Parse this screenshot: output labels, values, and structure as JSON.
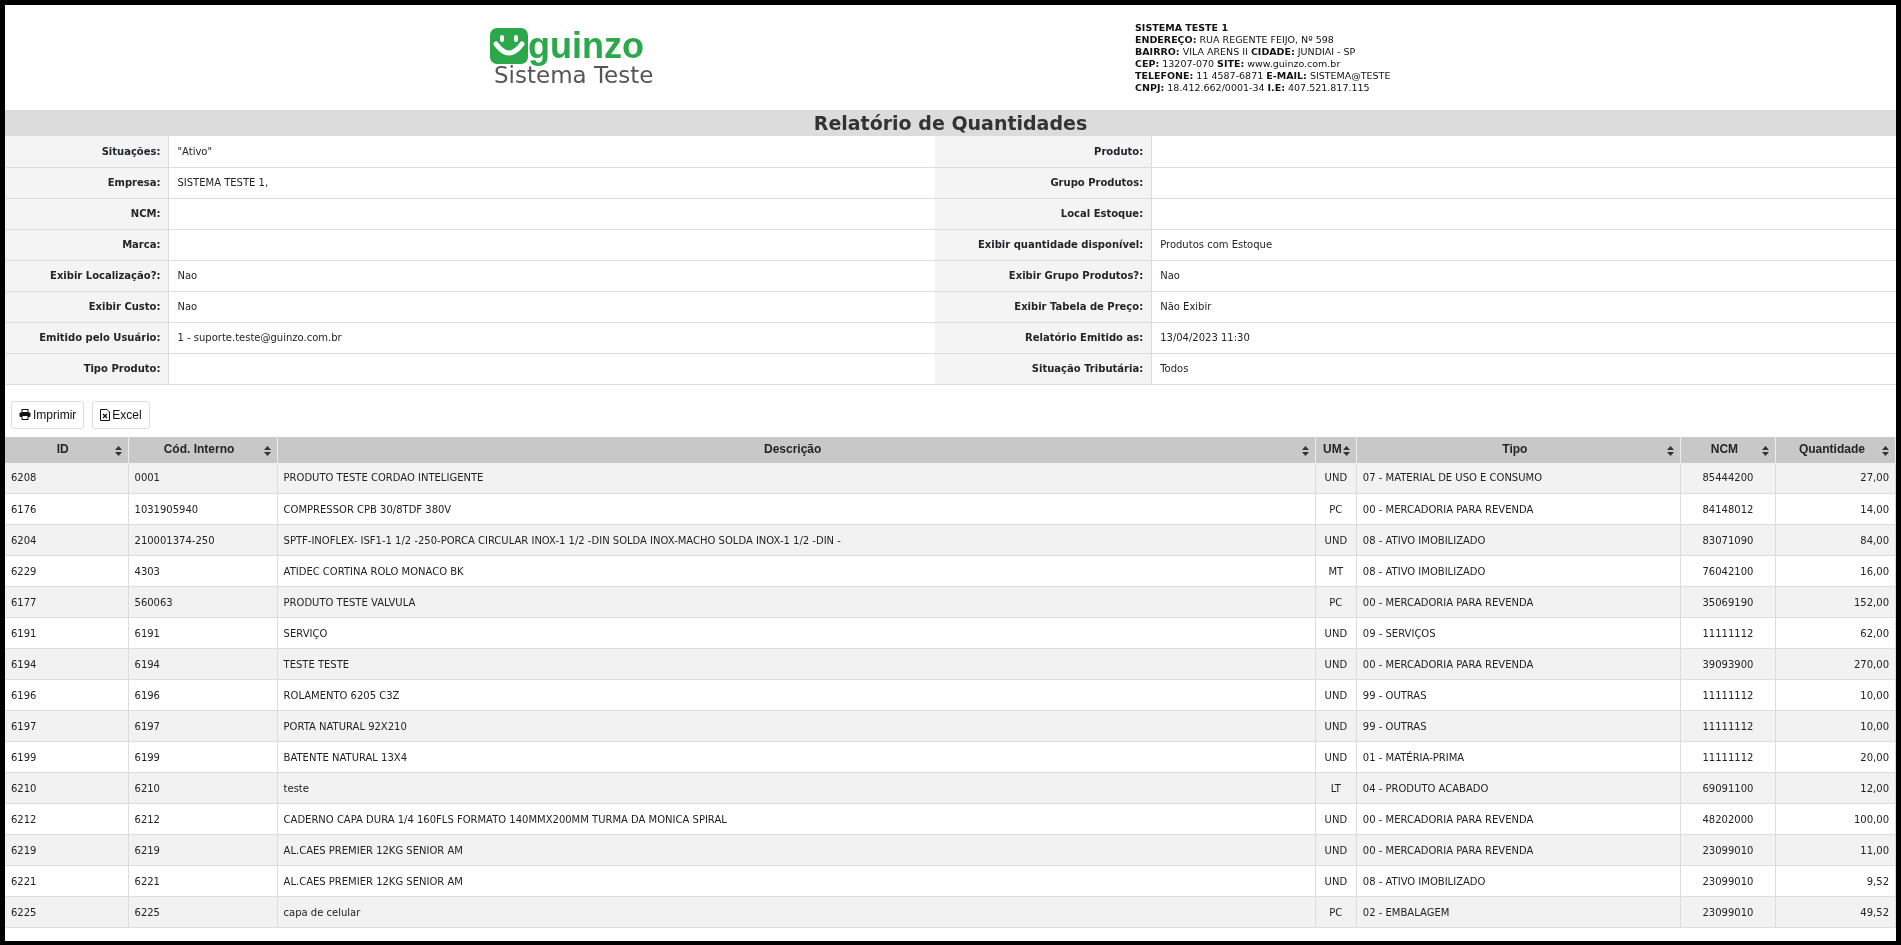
{
  "header": {
    "logo": {
      "brand": "guinzo",
      "subtitle": "Sistema Teste"
    },
    "company_lines": [
      "SISTEMA TESTE 1",
      "**ENDEREÇO:** RUA REGENTE FEIJO, Nº 598",
      "**BAIRRO:** VILA ARENS II **CIDADE:** JUNDIAI - SP",
      "**CEP:** 13207-070 **SITE:** www.guinzo.com.br",
      "**TELEFONE:** 11 4587-6871 **E-MAIL:** SISTEMA@TESTE",
      "**CNPJ:** 18.412.662/0001-34 **I.E:** 407.521.817.115"
    ]
  },
  "report_title": "Relatório de Quantidades",
  "filters": [
    {
      "left": {
        "label": "Situações:",
        "value": "\"Ativo\""
      },
      "right": {
        "label": "Produto:"
      }
    },
    {
      "left": {
        "label": "Empresa:",
        "value": "SISTEMA TESTE 1,"
      },
      "right": {
        "label": "Grupo Produtos:"
      }
    },
    {
      "left": {
        "label": "NCM:"
      },
      "right": {
        "label": "Local Estoque:"
      }
    },
    {
      "left": {
        "label": "Marca:"
      },
      "right": {
        "label": "Exibir quantidade disponível:",
        "value": "Produtos com Estoque"
      }
    },
    {
      "left": {
        "label": "Exibir Localização?:",
        "value": "Nao"
      },
      "right": {
        "label": "Exibir Grupo Produtos?:",
        "value": "Nao"
      }
    },
    {
      "left": {
        "label": "Exibir Custo:",
        "value": "Nao"
      },
      "right": {
        "label": "Exibir Tabela de Preço:",
        "value": "Não Exibir"
      }
    },
    {
      "left": {
        "label": "Emitido pelo Usuário:",
        "value": "1 - suporte.teste@guinzo.com.br"
      },
      "right": {
        "label": "Relatório Emitido as:",
        "value": "13/04/2023 11:30"
      }
    },
    {
      "left": {
        "label": "Tipo Produto:"
      },
      "right": {
        "label": "Situação Tributária:",
        "value": "Todos"
      }
    }
  ],
  "buttons": [
    {
      "label": "Imprimir",
      "kind": "print"
    },
    {
      "label": "Excel",
      "kind": "excel"
    }
  ],
  "table": {
    "columns": [
      {
        "label": "ID"
      },
      {
        "label": "Cód. Interno"
      },
      {
        "label": "Descrição"
      },
      {
        "label": "UM"
      },
      {
        "label": "Tipo"
      },
      {
        "label": "NCM"
      },
      {
        "label": "Quantidade"
      }
    ],
    "rows": [
      [
        "6208",
        "0001",
        "PRODUTO TESTE CORDAO INTELIGENTE",
        "UND",
        "07 - MATERIAL DE USO E CONSUMO",
        "85444200",
        "27,00"
      ],
      [
        "6176",
        "1031905940",
        "COMPRESSOR CPB 30/8TDF 380V",
        "PC",
        "00 - MERCADORIA PARA REVENDA",
        "84148012",
        "14,00"
      ],
      [
        "6204",
        "210001374-250",
        "SPTF-INOFLEX- ISF1-1 1/2 -250-PORCA CIRCULAR INOX-1 1/2 -DIN SOLDA INOX-MACHO SOLDA INOX-1 1/2 -DIN -",
        "UND",
        "08 - ATIVO IMOBILIZADO",
        "83071090",
        "84,00"
      ],
      [
        "6229",
        "4303",
        "ATIDEC CORTINA ROLO MONACO BK",
        "MT",
        "08 - ATIVO IMOBILIZADO",
        "76042100",
        "16,00"
      ],
      [
        "6177",
        "560063",
        "PRODUTO TESTE VALVULA",
        "PC",
        "00 - MERCADORIA PARA REVENDA",
        "35069190",
        "152,00"
      ],
      [
        "6191",
        "6191",
        "SERVIÇO",
        "UND",
        "09 - SERVIÇOS",
        "11111112",
        "62,00"
      ],
      [
        "6194",
        "6194",
        "TESTE TESTE",
        "UND",
        "00 - MERCADORIA PARA REVENDA",
        "39093900",
        "270,00"
      ],
      [
        "6196",
        "6196",
        "ROLAMENTO 6205 C3Z",
        "UND",
        "99 - OUTRAS",
        "11111112",
        "10,00"
      ],
      [
        "6197",
        "6197",
        "PORTA NATURAL 92X210",
        "UND",
        "99 - OUTRAS",
        "11111112",
        "10,00"
      ],
      [
        "6199",
        "6199",
        "BATENTE NATURAL 13X4",
        "UND",
        "01 - MATÉRIA-PRIMA",
        "11111112",
        "20,00"
      ],
      [
        "6210",
        "6210",
        "teste",
        "LT",
        "04 - PRODUTO ACABADO",
        "69091100",
        "12,00"
      ],
      [
        "6212",
        "6212",
        "CADERNO CAPA DURA 1/4 160FLS FORMATO 140MMX200MM TURMA DA MONICA SPIRAL",
        "UND",
        "00 - MERCADORIA PARA REVENDA",
        "48202000",
        "100,00"
      ],
      [
        "6219",
        "6219",
        "AL.CAES PREMIER 12KG SENIOR AM",
        "UND",
        "00 - MERCADORIA PARA REVENDA",
        "23099010",
        "11,00"
      ],
      [
        "6221",
        "6221",
        "AL.CAES PREMIER 12KG SENIOR AM",
        "UND",
        "08 - ATIVO IMOBILIZADO",
        "23099010",
        "9,52"
      ],
      [
        "6225",
        "6225",
        "capa de celular",
        "PC",
        "02 - EMBALAGEM",
        "23099010",
        "49,52"
      ]
    ]
  }
}
